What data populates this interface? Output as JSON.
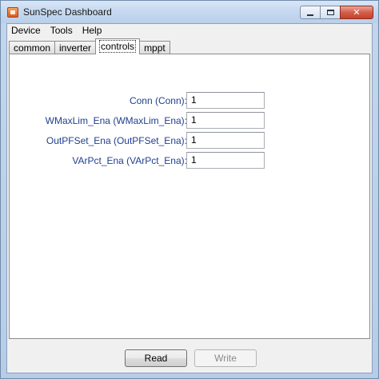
{
  "window": {
    "title": "SunSpec Dashboard",
    "minimize_symbol": "",
    "maximize_symbol": "",
    "close_symbol": "✕"
  },
  "menu": {
    "items": [
      {
        "label": "Device"
      },
      {
        "label": "Tools"
      },
      {
        "label": "Help"
      }
    ]
  },
  "tabs": [
    {
      "label": "common",
      "active": false
    },
    {
      "label": "inverter",
      "active": false
    },
    {
      "label": "controls",
      "active": true
    },
    {
      "label": "mppt",
      "active": false
    }
  ],
  "controls": {
    "fields": [
      {
        "label": "Conn  (Conn):",
        "value": "1"
      },
      {
        "label": "WMaxLim_Ena  (WMaxLim_Ena):",
        "value": "1"
      },
      {
        "label": "OutPFSet_Ena  (OutPFSet_Ena):",
        "value": "1"
      },
      {
        "label": "VArPct_Ena  (VArPct_Ena):",
        "value": "1"
      }
    ]
  },
  "buttons": {
    "read_label": "Read",
    "write_label": "Write",
    "write_enabled": false
  },
  "colors": {
    "label_text": "#1f3f8f",
    "close_button": "#c4422c",
    "title_bar": "#c5d8ef"
  },
  "icons": {
    "app": "app-icon",
    "minimize": "minimize-icon",
    "maximize": "maximize-icon",
    "close": "close-icon"
  }
}
